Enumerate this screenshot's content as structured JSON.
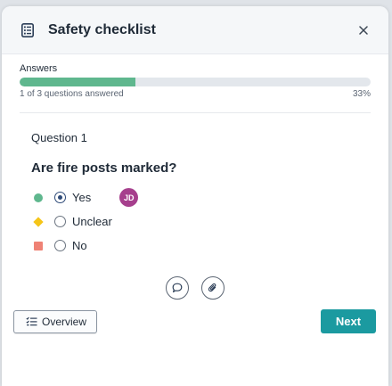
{
  "dialog": {
    "title": "Safety checklist",
    "close_icon": "close-icon",
    "header_icon": "checklist-icon"
  },
  "progress": {
    "label": "Answers",
    "status": "1 of 3 questions answered",
    "percent_text": "33%",
    "fraction": 0.33,
    "fill_color": "#5fb78e"
  },
  "question": {
    "number": "Question 1",
    "text": "Are fire posts marked?",
    "options": [
      {
        "label": "Yes",
        "marker": "circle",
        "color": "#5fb78e",
        "selected": true
      },
      {
        "label": "Unclear",
        "marker": "diamond",
        "color": "#f5c518",
        "selected": false
      },
      {
        "label": "No",
        "marker": "square",
        "color": "#ef8275",
        "selected": false
      }
    ],
    "answered_by": "JD",
    "avatar_color": "#a63f8d"
  },
  "actions": {
    "comment_icon": "comment-icon",
    "attach_icon": "paperclip-icon"
  },
  "footer": {
    "overview_label": "Overview",
    "overview_icon": "checklist-lines-icon",
    "next_label": "Next",
    "next_color": "#1b9aa0"
  }
}
